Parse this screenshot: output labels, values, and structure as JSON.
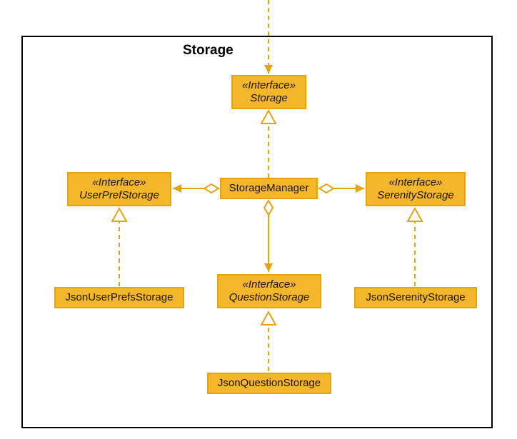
{
  "package": {
    "title": "Storage"
  },
  "nodes": {
    "storageIf": {
      "stereo": "«Interface»",
      "name": "Storage"
    },
    "storageManager": {
      "name": "StorageManager"
    },
    "userPrefIf": {
      "stereo": "«Interface»",
      "name": "UserPrefStorage"
    },
    "serenityIf": {
      "stereo": "«Interface»",
      "name": "SerenityStorage"
    },
    "questionIf": {
      "stereo": "«Interface»",
      "name": "QuestionStorage"
    },
    "jsonUserPrefs": {
      "name": "JsonUserPrefsStorage"
    },
    "jsonSerenity": {
      "name": "JsonSerenityStorage"
    },
    "jsonQuestion": {
      "name": "JsonQuestionStorage"
    }
  },
  "colors": {
    "box_fill": "#f4b72b",
    "box_border": "#e0a50f",
    "line": "#e0a50f",
    "pkg_border": "#000000"
  },
  "chart_data": {
    "type": "diagram",
    "title": "Storage",
    "diagram_kind": "UML class / package diagram",
    "package": "Storage",
    "nodes": [
      {
        "id": "Storage",
        "stereotype": "Interface",
        "kind": "interface"
      },
      {
        "id": "StorageManager",
        "kind": "class"
      },
      {
        "id": "UserPrefStorage",
        "stereotype": "Interface",
        "kind": "interface"
      },
      {
        "id": "SerenityStorage",
        "stereotype": "Interface",
        "kind": "interface"
      },
      {
        "id": "QuestionStorage",
        "stereotype": "Interface",
        "kind": "interface"
      },
      {
        "id": "JsonUserPrefsStorage",
        "kind": "class"
      },
      {
        "id": "JsonSerenityStorage",
        "kind": "class"
      },
      {
        "id": "JsonQuestionStorage",
        "kind": "class"
      }
    ],
    "edges": [
      {
        "from": "StorageManager",
        "to": "Storage",
        "relation": "realization"
      },
      {
        "from": "StorageManager",
        "to": "UserPrefStorage",
        "relation": "aggregation",
        "whole": "StorageManager"
      },
      {
        "from": "StorageManager",
        "to": "SerenityStorage",
        "relation": "aggregation",
        "whole": "StorageManager"
      },
      {
        "from": "StorageManager",
        "to": "QuestionStorage",
        "relation": "aggregation",
        "whole": "StorageManager"
      },
      {
        "from": "JsonUserPrefsStorage",
        "to": "UserPrefStorage",
        "relation": "realization"
      },
      {
        "from": "JsonSerenityStorage",
        "to": "SerenityStorage",
        "relation": "realization"
      },
      {
        "from": "JsonQuestionStorage",
        "to": "QuestionStorage",
        "relation": "realization"
      },
      {
        "from": "(external)",
        "to": "Storage",
        "relation": "dependency",
        "note": "dashed line entering package from above"
      }
    ]
  }
}
